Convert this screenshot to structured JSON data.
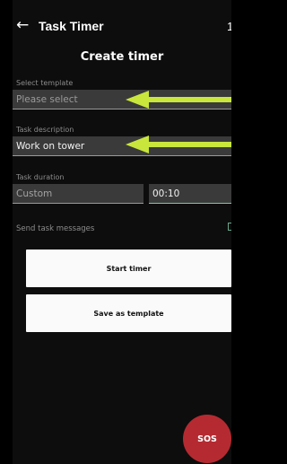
{
  "app": {
    "back_icon": "arrow-left-icon",
    "title": "Task Timer",
    "corner_text": "1"
  },
  "screen": {
    "title": "Create timer"
  },
  "template": {
    "label": "Select template",
    "placeholder": "Please select"
  },
  "description": {
    "label": "Task description",
    "value": "Work on tower"
  },
  "duration": {
    "label": "Task duration",
    "mode": "Custom",
    "time": "00:10"
  },
  "messages": {
    "label": "Send task messages",
    "checked": false
  },
  "buttons": {
    "start": "Start timer",
    "save_template": "Save as template",
    "sos": "SOS"
  },
  "colors": {
    "background": "#0d0d0d",
    "field": "#3a3a3a",
    "annotation_arrow": "#c8e63c",
    "accent_green": "#7fc9a0",
    "sos": "#b52a31"
  }
}
